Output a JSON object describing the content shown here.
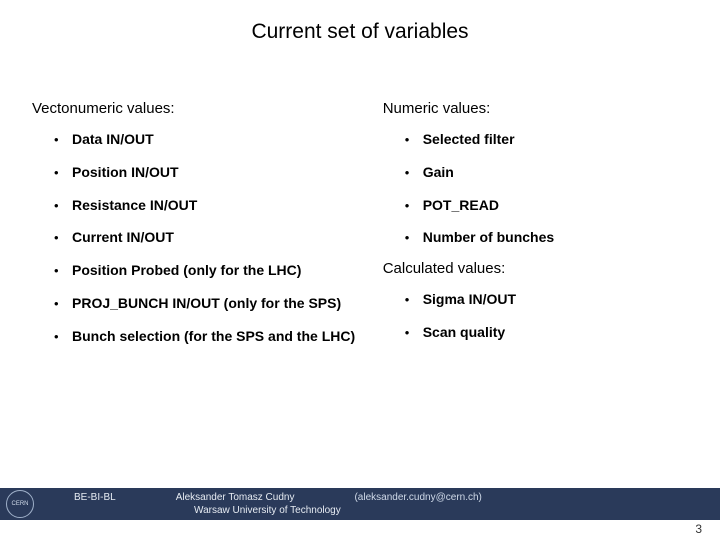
{
  "title": "Current set of variables",
  "left": {
    "heading": "Vectonumeric values:",
    "items": [
      "Data IN/OUT",
      "Position IN/OUT",
      "Resistance IN/OUT",
      "Current IN/OUT",
      "Position Probed (only for the LHC)",
      "PROJ_BUNCH IN/OUT (only for the SPS)",
      "Bunch selection (for the SPS and the LHC)"
    ]
  },
  "right": {
    "heading1": "Numeric values:",
    "items1": [
      "Selected filter",
      "Gain",
      "POT_READ",
      "Number of bunches"
    ],
    "heading2": "Calculated values:",
    "items2": [
      "Sigma IN/OUT",
      "Scan quality"
    ]
  },
  "footer": {
    "logo": "CERN",
    "dept": "BE-BI-BL",
    "author": "Aleksander Tomasz Cudny",
    "email": "(aleksander.cudny@cern.ch)",
    "affiliation": "Warsaw University of Technology"
  },
  "page": "3"
}
